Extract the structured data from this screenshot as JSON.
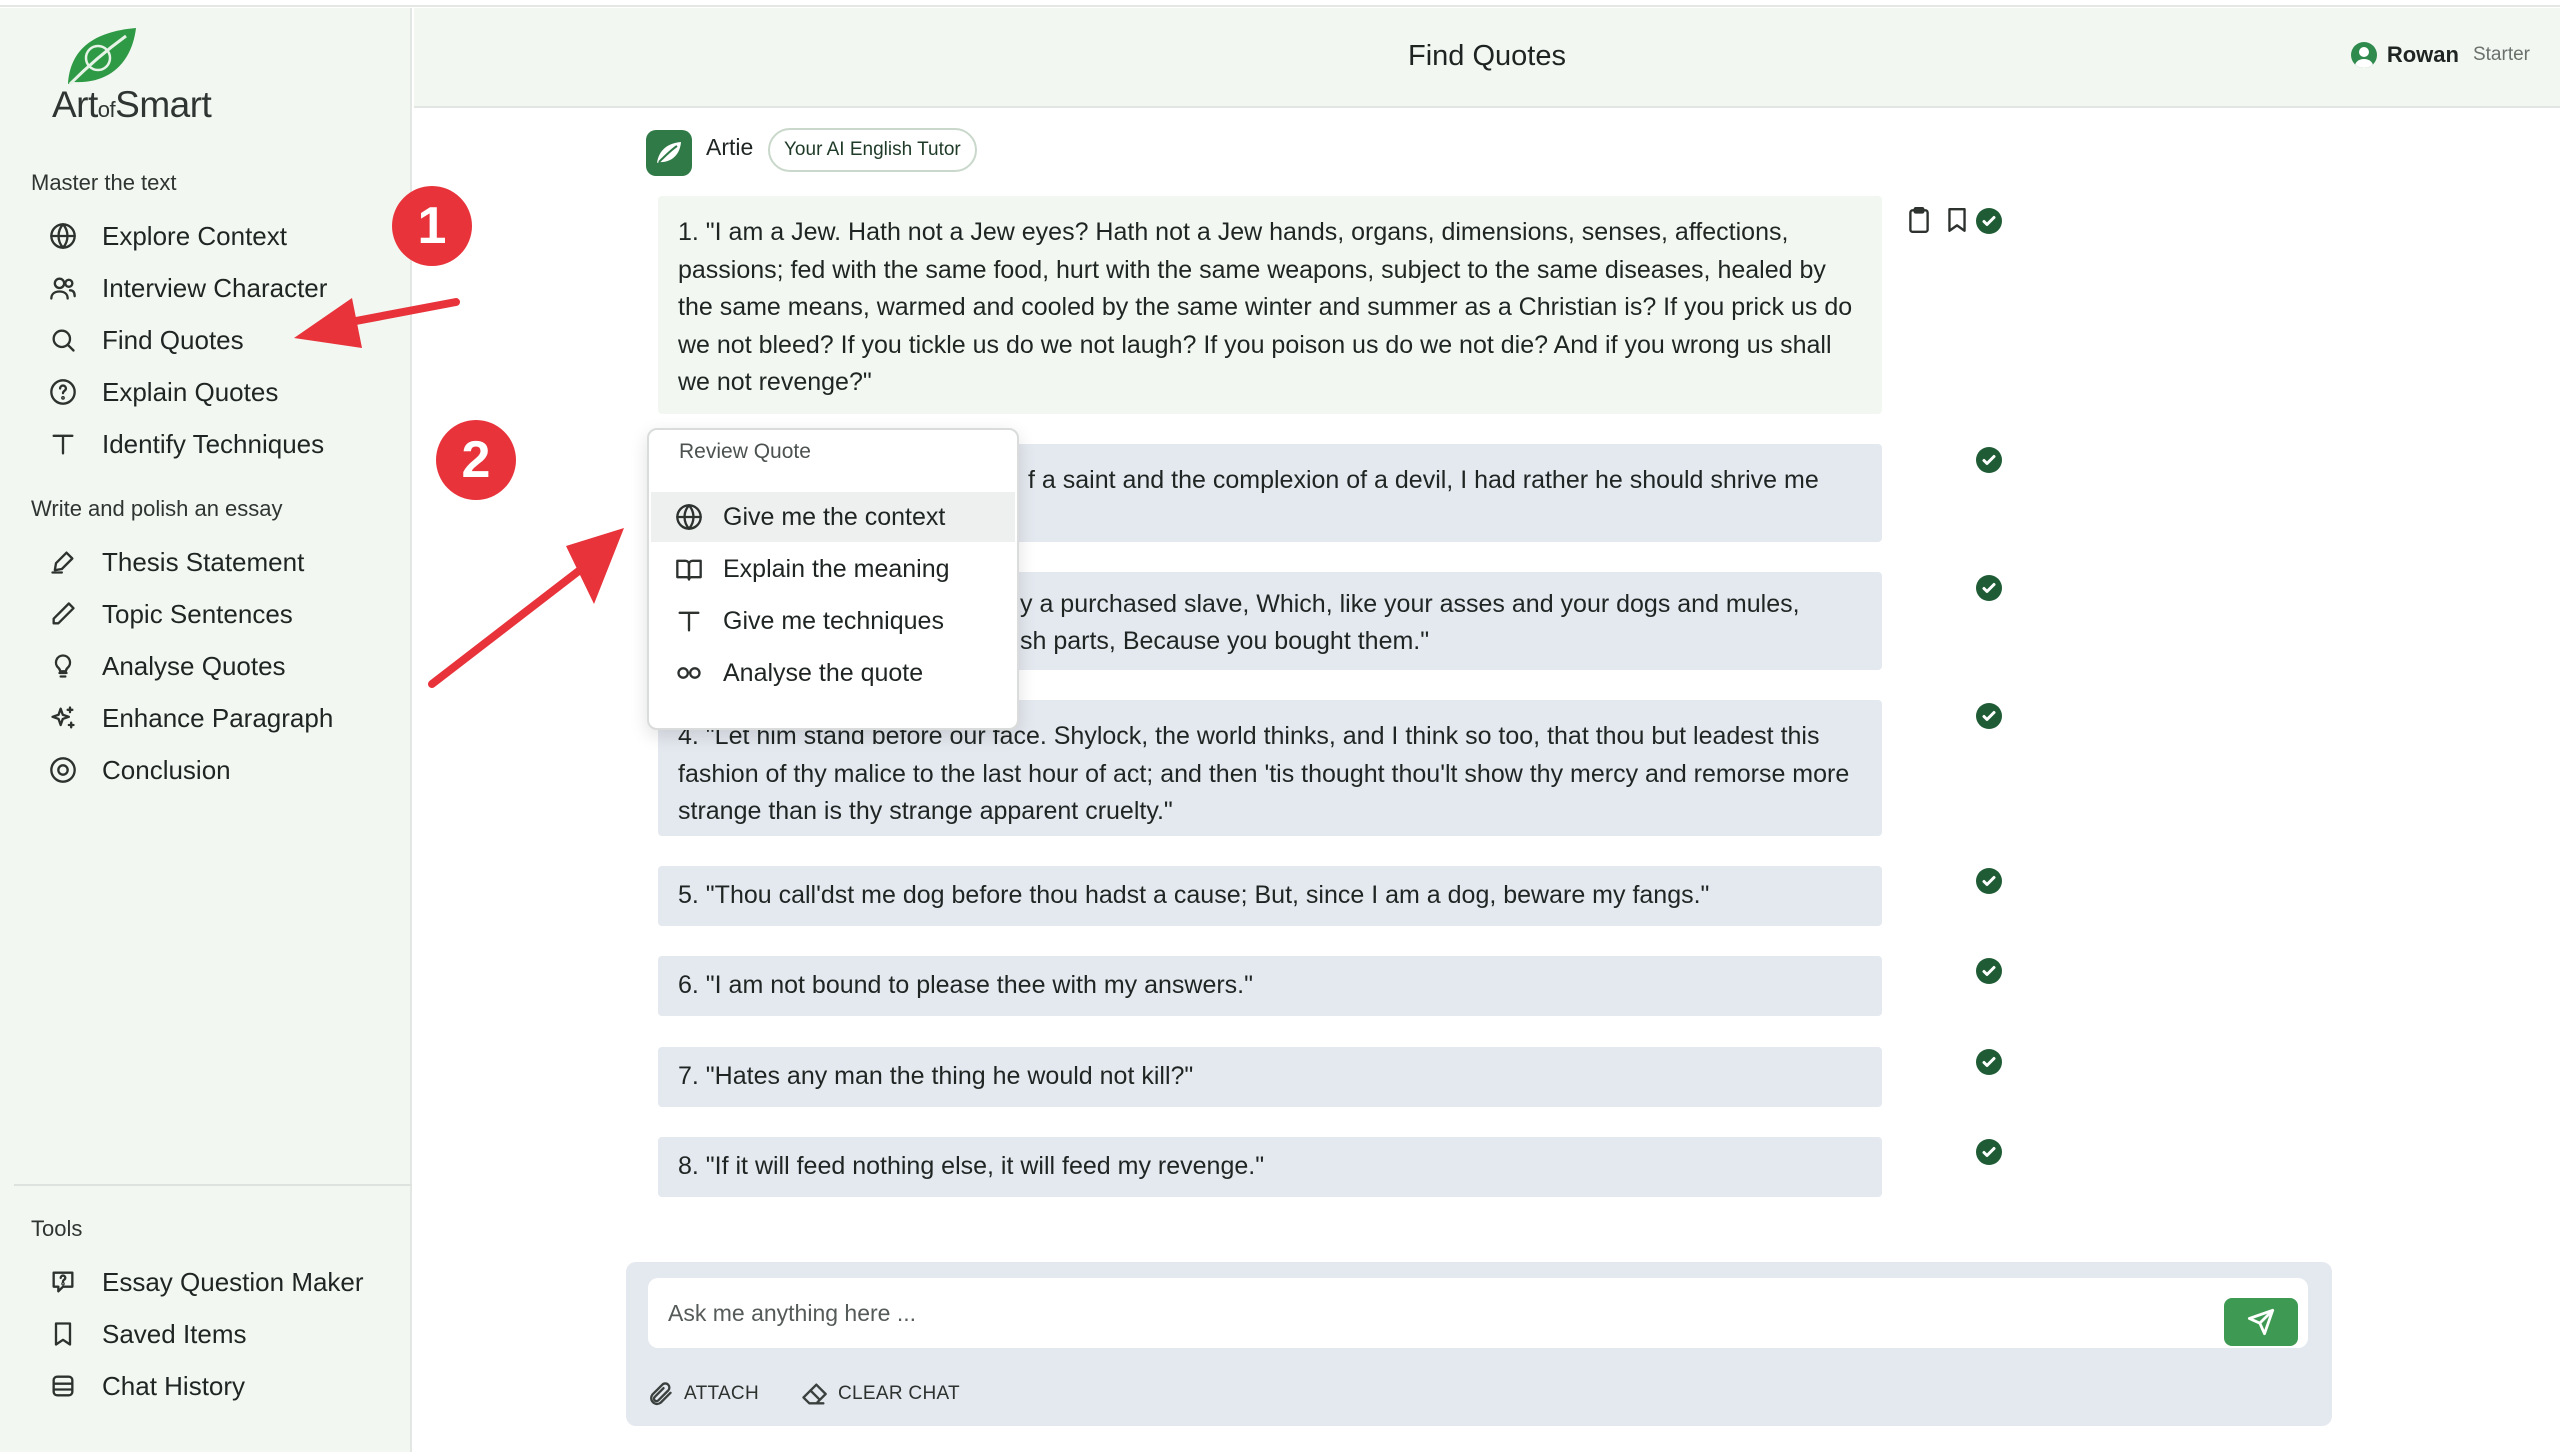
{
  "brand": {
    "logo_prefix": "Art",
    "logo_mid": "of",
    "logo_suffix": "Smart"
  },
  "sidebar": {
    "section1": "Master the text",
    "section1_items": [
      {
        "label": "Explore Context",
        "icon": "globe-icon"
      },
      {
        "label": "Interview Character",
        "icon": "users-icon"
      },
      {
        "label": "Find Quotes",
        "icon": "search-icon"
      },
      {
        "label": "Explain Quotes",
        "icon": "help-circle-icon"
      },
      {
        "label": "Identify Techniques",
        "icon": "type-icon"
      }
    ],
    "section2": "Write and polish an essay",
    "section2_items": [
      {
        "label": "Thesis Statement",
        "icon": "pen-tool-icon"
      },
      {
        "label": "Topic Sentences",
        "icon": "pencil-icon"
      },
      {
        "label": "Analyse Quotes",
        "icon": "lightbulb-icon"
      },
      {
        "label": "Enhance Paragraph",
        "icon": "sparkles-icon"
      },
      {
        "label": "Conclusion",
        "icon": "target-icon"
      }
    ],
    "section3": "Tools",
    "section3_items": [
      {
        "label": "Essay Question Maker",
        "icon": "question-message-icon"
      },
      {
        "label": "Saved Items",
        "icon": "bookmark-icon"
      },
      {
        "label": "Chat History",
        "icon": "archive-icon"
      }
    ]
  },
  "header": {
    "title": "Find Quotes",
    "user_name": "Rowan",
    "user_plan": "Starter"
  },
  "bot": {
    "name": "Artie",
    "badge": "Your AI English Tutor"
  },
  "quotes": [
    "1. \"I am a Jew. Hath not a Jew eyes? Hath not a Jew hands, organs, dimensions, senses, affections, passions; fed with the same food, hurt with the same weapons, subject to the same diseases, healed by the same means, warmed and cooled by the same winter and summer as a Christian is? If you prick us do we not bleed? If you tickle us do we not laugh? If you poison us do we not die? And if you wrong us shall we not revenge?\"",
    "f a saint and the complexion of a devil, I had rather he should shrive me",
    "y a purchased slave, Which, like your asses and your dogs and mules,",
    "sh parts, Because you bought them.\"",
    "4. \"Let him stand before our face. Shylock, the world thinks, and I think so too, that thou but leadest this fashion of thy malice to the last hour of act; and then 'tis thought thou'lt show thy mercy and remorse more strange than is thy strange apparent cruelty.\"",
    "5. \"Thou call'dst me dog before thou hadst a cause; But, since I am a dog, beware my fangs.\"",
    "6. \"I am not bound to please thee with my answers.\"",
    "7. \"Hates any man the thing he would not kill?\"",
    "8. \"If it will feed nothing else, it will feed my revenge.\""
  ],
  "popover": {
    "title": "Review Quote",
    "items": [
      {
        "label": "Give me the context",
        "icon": "globe-icon"
      },
      {
        "label": "Explain the meaning",
        "icon": "book-open-icon"
      },
      {
        "label": "Give me techniques",
        "icon": "type-icon"
      },
      {
        "label": "Analyse the quote",
        "icon": "infinity-icon"
      }
    ]
  },
  "composer": {
    "placeholder": "Ask me anything here ...",
    "attach": "ATTACH",
    "clear": "CLEAR CHAT"
  },
  "annotations": {
    "badge1": "1",
    "badge2": "2"
  },
  "colors": {
    "accent": "#2f7a46",
    "sidebar_bg": "#f2f7f1",
    "quote_bg": "#e4e8ef",
    "annotation": "#e8333b"
  }
}
